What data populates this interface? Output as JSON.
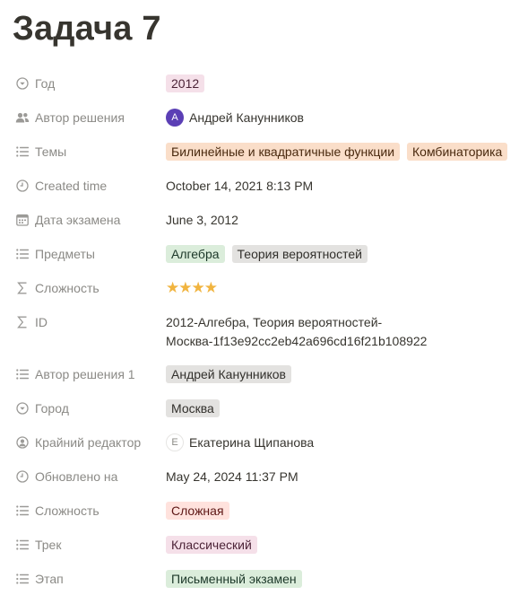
{
  "page": {
    "title": "Задача 7"
  },
  "colors": {
    "text": "#37352f",
    "label": "#8b8a86",
    "tag_pink": "#f5e0e9",
    "tag_orange": "#fadec9",
    "tag_green": "#dbeddb",
    "tag_gray": "#e3e2e0",
    "tag_red": "#ffe2dd",
    "avatar": "#5b3fb5",
    "star": "#f1b43f"
  },
  "properties": {
    "year": {
      "icon": "select-icon",
      "label": "Год",
      "value": "2012"
    },
    "solution_author": {
      "icon": "people-icon",
      "label": "Автор решения",
      "avatar_initial": "А",
      "value": "Андрей Канунников"
    },
    "topics": {
      "icon": "list-icon",
      "label": "Темы",
      "tags": [
        "Билинейные и квадратичные функции",
        "Комбинаторика"
      ]
    },
    "created_time": {
      "icon": "clock-icon",
      "label": "Created time",
      "value": "October 14, 2021 8:13 PM"
    },
    "exam_date": {
      "icon": "calendar-icon",
      "label": "Дата экзамена",
      "value": "June 3, 2012"
    },
    "subjects": {
      "icon": "list-icon",
      "label": "Предметы",
      "tags": [
        "Алгебра",
        "Теория вероятностей"
      ]
    },
    "difficulty_formula": {
      "icon": "sigma-icon",
      "label": "Сложность",
      "value": "★★★★",
      "rating": 4
    },
    "id": {
      "icon": "sigma-icon",
      "label": "ID",
      "line1": "2012-Алгебра, Теория вероятностей-",
      "line2": "Москва-1f13e92cc2eb42a696cd16f21b108922"
    },
    "solution_author_1": {
      "icon": "list-icon",
      "label": "Автор решения 1",
      "value": "Андрей Канунников"
    },
    "city": {
      "icon": "select-icon",
      "label": "Город",
      "value": "Москва"
    },
    "last_editor": {
      "icon": "person-icon",
      "label": "Крайний редактор",
      "avatar_initial": "Е",
      "value": "Екатерина Щипанова"
    },
    "updated_at": {
      "icon": "clock-icon",
      "label": "Обновлено на",
      "value": "May 24, 2024 11:37 PM"
    },
    "difficulty": {
      "icon": "list-icon",
      "label": "Сложность",
      "value": "Сложная"
    },
    "track": {
      "icon": "list-icon",
      "label": "Трек",
      "value": "Классический"
    },
    "stage": {
      "icon": "list-icon",
      "label": "Этап",
      "value": "Письменный экзамен"
    }
  }
}
